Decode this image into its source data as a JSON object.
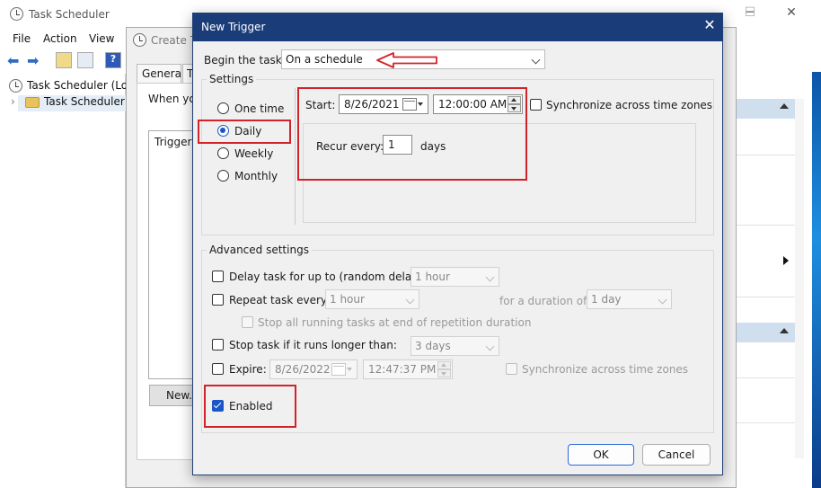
{
  "background_window": {
    "title": "Task Scheduler",
    "menu": [
      "File",
      "Action",
      "View"
    ],
    "tree": [
      "Task Scheduler (Loca",
      "Task Scheduler Li"
    ]
  },
  "create_task_window": {
    "title": "Create Ta",
    "tabs": [
      "General",
      "T"
    ],
    "when_text": "When yo",
    "trigger_header": "Trigger",
    "new_button": "New..."
  },
  "dialog": {
    "title": "New Trigger",
    "begin_label": "Begin the task:",
    "begin_value": "On a schedule",
    "settings_label": "Settings",
    "schedule_options": [
      "One time",
      "Daily",
      "Weekly",
      "Monthly"
    ],
    "selected_schedule": "Daily",
    "start_label": "Start:",
    "start_date": "8/26/2021",
    "start_time": "12:00:00 AM",
    "sync_label": "Synchronize across time zones",
    "recur_label": "Recur every:",
    "recur_value": "1",
    "recur_unit": "days",
    "advanced_label": "Advanced settings",
    "delay_label": "Delay task for up to (random delay):",
    "delay_value": "1 hour",
    "repeat_label": "Repeat task every:",
    "repeat_value": "1 hour",
    "duration_label": "for a duration of:",
    "duration_value": "1 day",
    "stop_running_label": "Stop all running tasks at end of repetition duration",
    "stop_longer_label": "Stop task if it runs longer than:",
    "stop_longer_value": "3 days",
    "expire_label": "Expire:",
    "expire_date": "8/26/2022",
    "expire_time": "12:47:37 PM",
    "expire_sync_label": "Synchronize across time zones",
    "enabled_label": "Enabled",
    "enabled": true,
    "ok_label": "OK",
    "cancel_label": "Cancel",
    "close_glyph": "✕"
  },
  "colors": {
    "titlebar": "#1a3c78",
    "accent": "#1a56c8",
    "highlight": "#d2232a"
  },
  "icons": [
    "clock-icon",
    "folder-icon",
    "back-arrow-icon",
    "forward-arrow-icon",
    "help-icon",
    "calendar-icon",
    "close-icon",
    "red-arrow-annotation-icon"
  ]
}
